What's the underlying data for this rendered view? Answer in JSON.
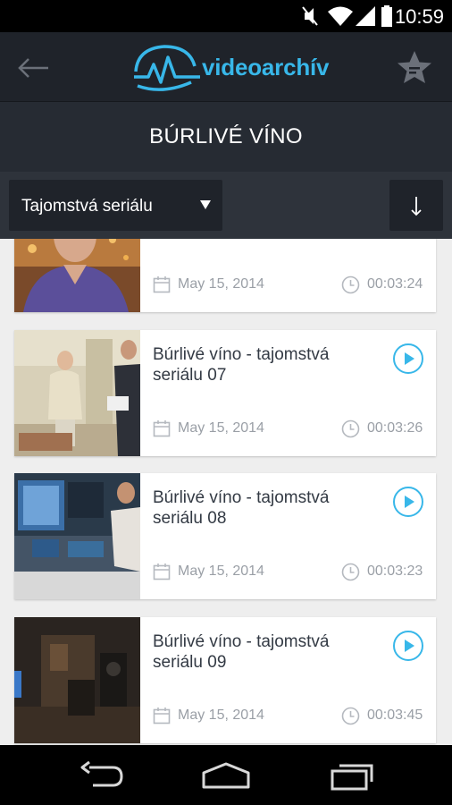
{
  "status_bar": {
    "time": "10:59",
    "icons": [
      "mute-icon",
      "wifi-icon",
      "signal-icon",
      "battery-icon"
    ]
  },
  "app_bar": {
    "logo_text": "videoarchív",
    "back_icon": "back-arrow-icon",
    "favorite_icon": "star-list-icon"
  },
  "title_bar": {
    "title": "BÚRLIVÉ VÍNO"
  },
  "filter_bar": {
    "dropdown_selected": "Tajomstvá seriálu",
    "sort_icon": "arrow-down-icon"
  },
  "videos": [
    {
      "title": "",
      "date": "May 15, 2014",
      "duration": "00:03:24"
    },
    {
      "title": "Búrlivé víno - tajomstvá seriálu 07",
      "date": "May 15, 2014",
      "duration": "00:03:26"
    },
    {
      "title": "Búrlivé víno - tajomstvá seriálu 08",
      "date": "May 15, 2014",
      "duration": "00:03:23"
    },
    {
      "title": "Búrlivé víno - tajomstvá seriálu 09",
      "date": "May 15, 2014",
      "duration": "00:03:45"
    }
  ],
  "colors": {
    "accent": "#38b7e9",
    "header_bg": "#1f232a",
    "title_bg": "#262b33",
    "filter_bg": "#2e333b",
    "list_bg": "#eeeeee"
  },
  "nav_bar": {
    "icons": [
      "nav-back-icon",
      "nav-home-icon",
      "nav-recents-icon"
    ]
  }
}
